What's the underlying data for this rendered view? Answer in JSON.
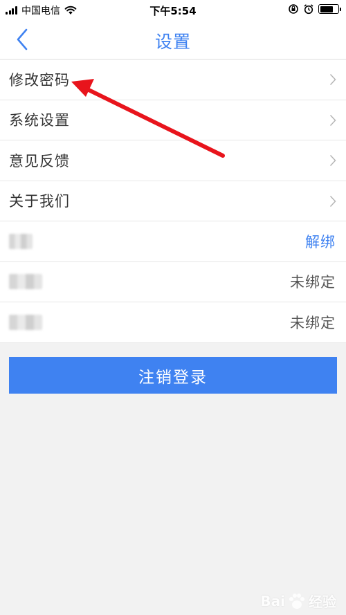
{
  "status_bar": {
    "carrier": "中国电信",
    "time": "下午5:54",
    "battery_level": 0.75
  },
  "nav": {
    "title": "设置",
    "back_icon": "chevron-left-icon"
  },
  "menu": {
    "items": [
      {
        "label": "修改密码"
      },
      {
        "label": "系统设置"
      },
      {
        "label": "意见反馈"
      },
      {
        "label": "关于我们"
      }
    ]
  },
  "bindings": {
    "rows": [
      {
        "action": "解绑"
      },
      {
        "status": "未绑定"
      },
      {
        "status": "未绑定"
      }
    ]
  },
  "logout": {
    "label": "注销登录"
  },
  "watermark": {
    "left": "Bai",
    "right": "经验"
  },
  "colors": {
    "accent": "#3f82f1",
    "background": "#f2f2f2",
    "annotation_arrow": "#e8141c"
  }
}
